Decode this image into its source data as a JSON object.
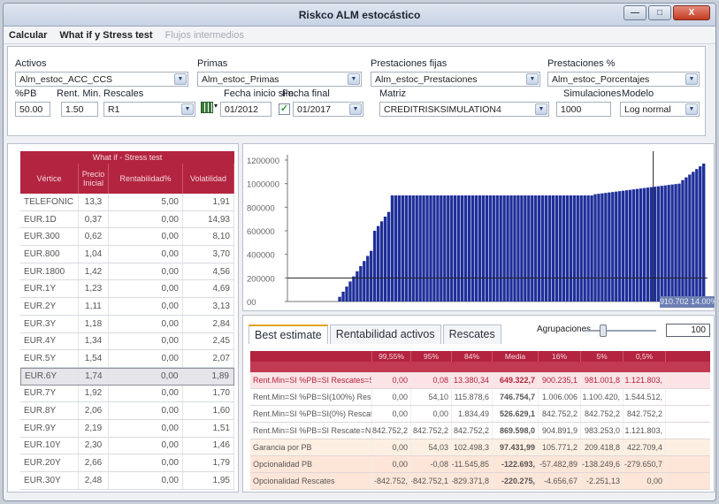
{
  "window": {
    "title": "Riskco ALM estocástico"
  },
  "menu": {
    "calcular": "Calcular",
    "whatif": "What if y Stress test",
    "flujos": "Flujos intermedios"
  },
  "params": {
    "activos_label": "Activos",
    "activos_value": "Alm_estoc_ACC_CCS",
    "primas_label": "Primas",
    "primas_value": "Alm_estoc_Primas",
    "prest_fijas_label": "Prestaciones fijas",
    "prest_fijas_value": "Alm_estoc_Prestaciones",
    "prest_pct_label": "Prestaciones %",
    "prest_pct_value": "Alm_estoc_Porcentajes",
    "pb_label": "%PB",
    "pb_value": "50.00",
    "rent_label": "Rent. Min.",
    "rent_value": "1.50",
    "rescales_label": "Rescales",
    "rescales_value": "R1",
    "fecha_inicio_label": "Fecha inicio sim.",
    "fecha_inicio_value": "01/2012",
    "fecha_final_label": "Fecha final",
    "fecha_final_value": "01/2017",
    "matriz_label": "Matriz",
    "matriz_value": "CREDITRISKSIMULATION4",
    "sim_label": "Simulaciones",
    "sim_value": "1000",
    "modelo_label": "Modelo",
    "modelo_value": "Log normal",
    "check": "✓"
  },
  "whatif_table": {
    "title": "What if - Stress test",
    "headers": [
      "Vértice",
      "Precio Inicial",
      "Rentabilidad%",
      "Volatilidad"
    ],
    "rows": [
      [
        "TELEFONIC",
        "13,3",
        "5,00",
        "1,91"
      ],
      [
        "EUR.1D",
        "0,37",
        "0,00",
        "14,93"
      ],
      [
        "EUR.300",
        "0,62",
        "0,00",
        "8,10"
      ],
      [
        "EUR.800",
        "1,04",
        "0,00",
        "3,70"
      ],
      [
        "EUR.1800",
        "1,42",
        "0,00",
        "4,56"
      ],
      [
        "EUR.1Y",
        "1,23",
        "0,00",
        "4,69"
      ],
      [
        "EUR.2Y",
        "1,11",
        "0,00",
        "3,13"
      ],
      [
        "EUR.3Y",
        "1,18",
        "0,00",
        "2,84"
      ],
      [
        "EUR.4Y",
        "1,34",
        "0,00",
        "2,45"
      ],
      [
        "EUR.5Y",
        "1,54",
        "0,00",
        "2,07"
      ],
      [
        "EUR.6Y",
        "1,74",
        "0,00",
        "1,89"
      ],
      [
        "EUR.7Y",
        "1,92",
        "0,00",
        "1,70"
      ],
      [
        "EUR.8Y",
        "2,06",
        "0,00",
        "1,60"
      ],
      [
        "EUR.9Y",
        "2,19",
        "0,00",
        "1,51"
      ],
      [
        "EUR.10Y",
        "2,30",
        "0,00",
        "1,46"
      ],
      [
        "EUR.20Y",
        "2,66",
        "0,00",
        "1,79"
      ],
      [
        "EUR.30Y",
        "2,48",
        "0,00",
        "1,95"
      ]
    ],
    "selected_row": 10
  },
  "chart_data": {
    "type": "bar",
    "title": "",
    "ylim": [
      0,
      1200000
    ],
    "yticks": [
      "1200000",
      "1000000",
      "800000",
      "600000",
      "400000",
      "200000",
      "00"
    ],
    "bar_color": "#1f2f9a",
    "segments": [
      {
        "count": 14,
        "from": 0,
        "to": 0
      },
      {
        "count": 10,
        "from": 40000,
        "to": 430000
      },
      {
        "count": 5,
        "from": 600000,
        "to": 760000
      },
      {
        "count": 58,
        "from": 900000,
        "to": 900000
      },
      {
        "count": 25,
        "from": 910000,
        "to": 1000000
      },
      {
        "count": 7,
        "from": 1030000,
        "to": 1170000
      }
    ],
    "hline_value": 200000,
    "cursor_label": "910.702 14.00%"
  },
  "results": {
    "tabs": [
      "Best estimate",
      "Rentabilidad activos",
      "Rescates"
    ],
    "agrupaciones_label": "Agrupaciones",
    "agrupaciones_value": "100",
    "headers": [
      "",
      "99,55%",
      "95%",
      "84%",
      "Media",
      "16%",
      "5%",
      "0,5%"
    ],
    "rows": [
      [
        "Rent.Min=SI %PB=SI Rescates=S",
        "0,00",
        "0,08",
        "13.380,34",
        "649.322,7",
        "900.235,1",
        "981.001,8",
        "1.121.803,"
      ],
      [
        "Rent.Min=SI %PB=SI(100%) Resc",
        "0,00",
        "54,10",
        "115.878,6",
        "746.754,7",
        "1.006.006",
        "1.100.420,",
        "1.544.512,"
      ],
      [
        "Rent.Min=SI %PB=SI(0%) Rescat",
        "0,00",
        "0,00",
        "1.834,49",
        "526.629,1",
        "842.752,2",
        "842.752,2",
        "842.752,2"
      ],
      [
        "Rent.Min=SI %PB=SI Rescate=N",
        "842.752,2",
        "842.752,2",
        "842.752,2",
        "869.598,0",
        "904.891,9",
        "983.253,0",
        "1.121.803,"
      ],
      [
        "Garancia por PB",
        "0,00",
        "54,03",
        "102.498,3",
        "97.431,99",
        "105.771,2",
        "209.418,8",
        "422.709,4"
      ],
      [
        "Opcionalidad PB",
        "0,00",
        "-0,08",
        "-11.545,85",
        "-122.693,",
        "-57.482,89",
        "-138.249,6",
        "-279.650,7"
      ],
      [
        "Opcionalidad Rescates",
        "-842.752,",
        "-842.752,1",
        "-829.371,8",
        "-220.275,",
        "-4.656,67",
        "-2.251,13",
        "0,00"
      ]
    ]
  }
}
